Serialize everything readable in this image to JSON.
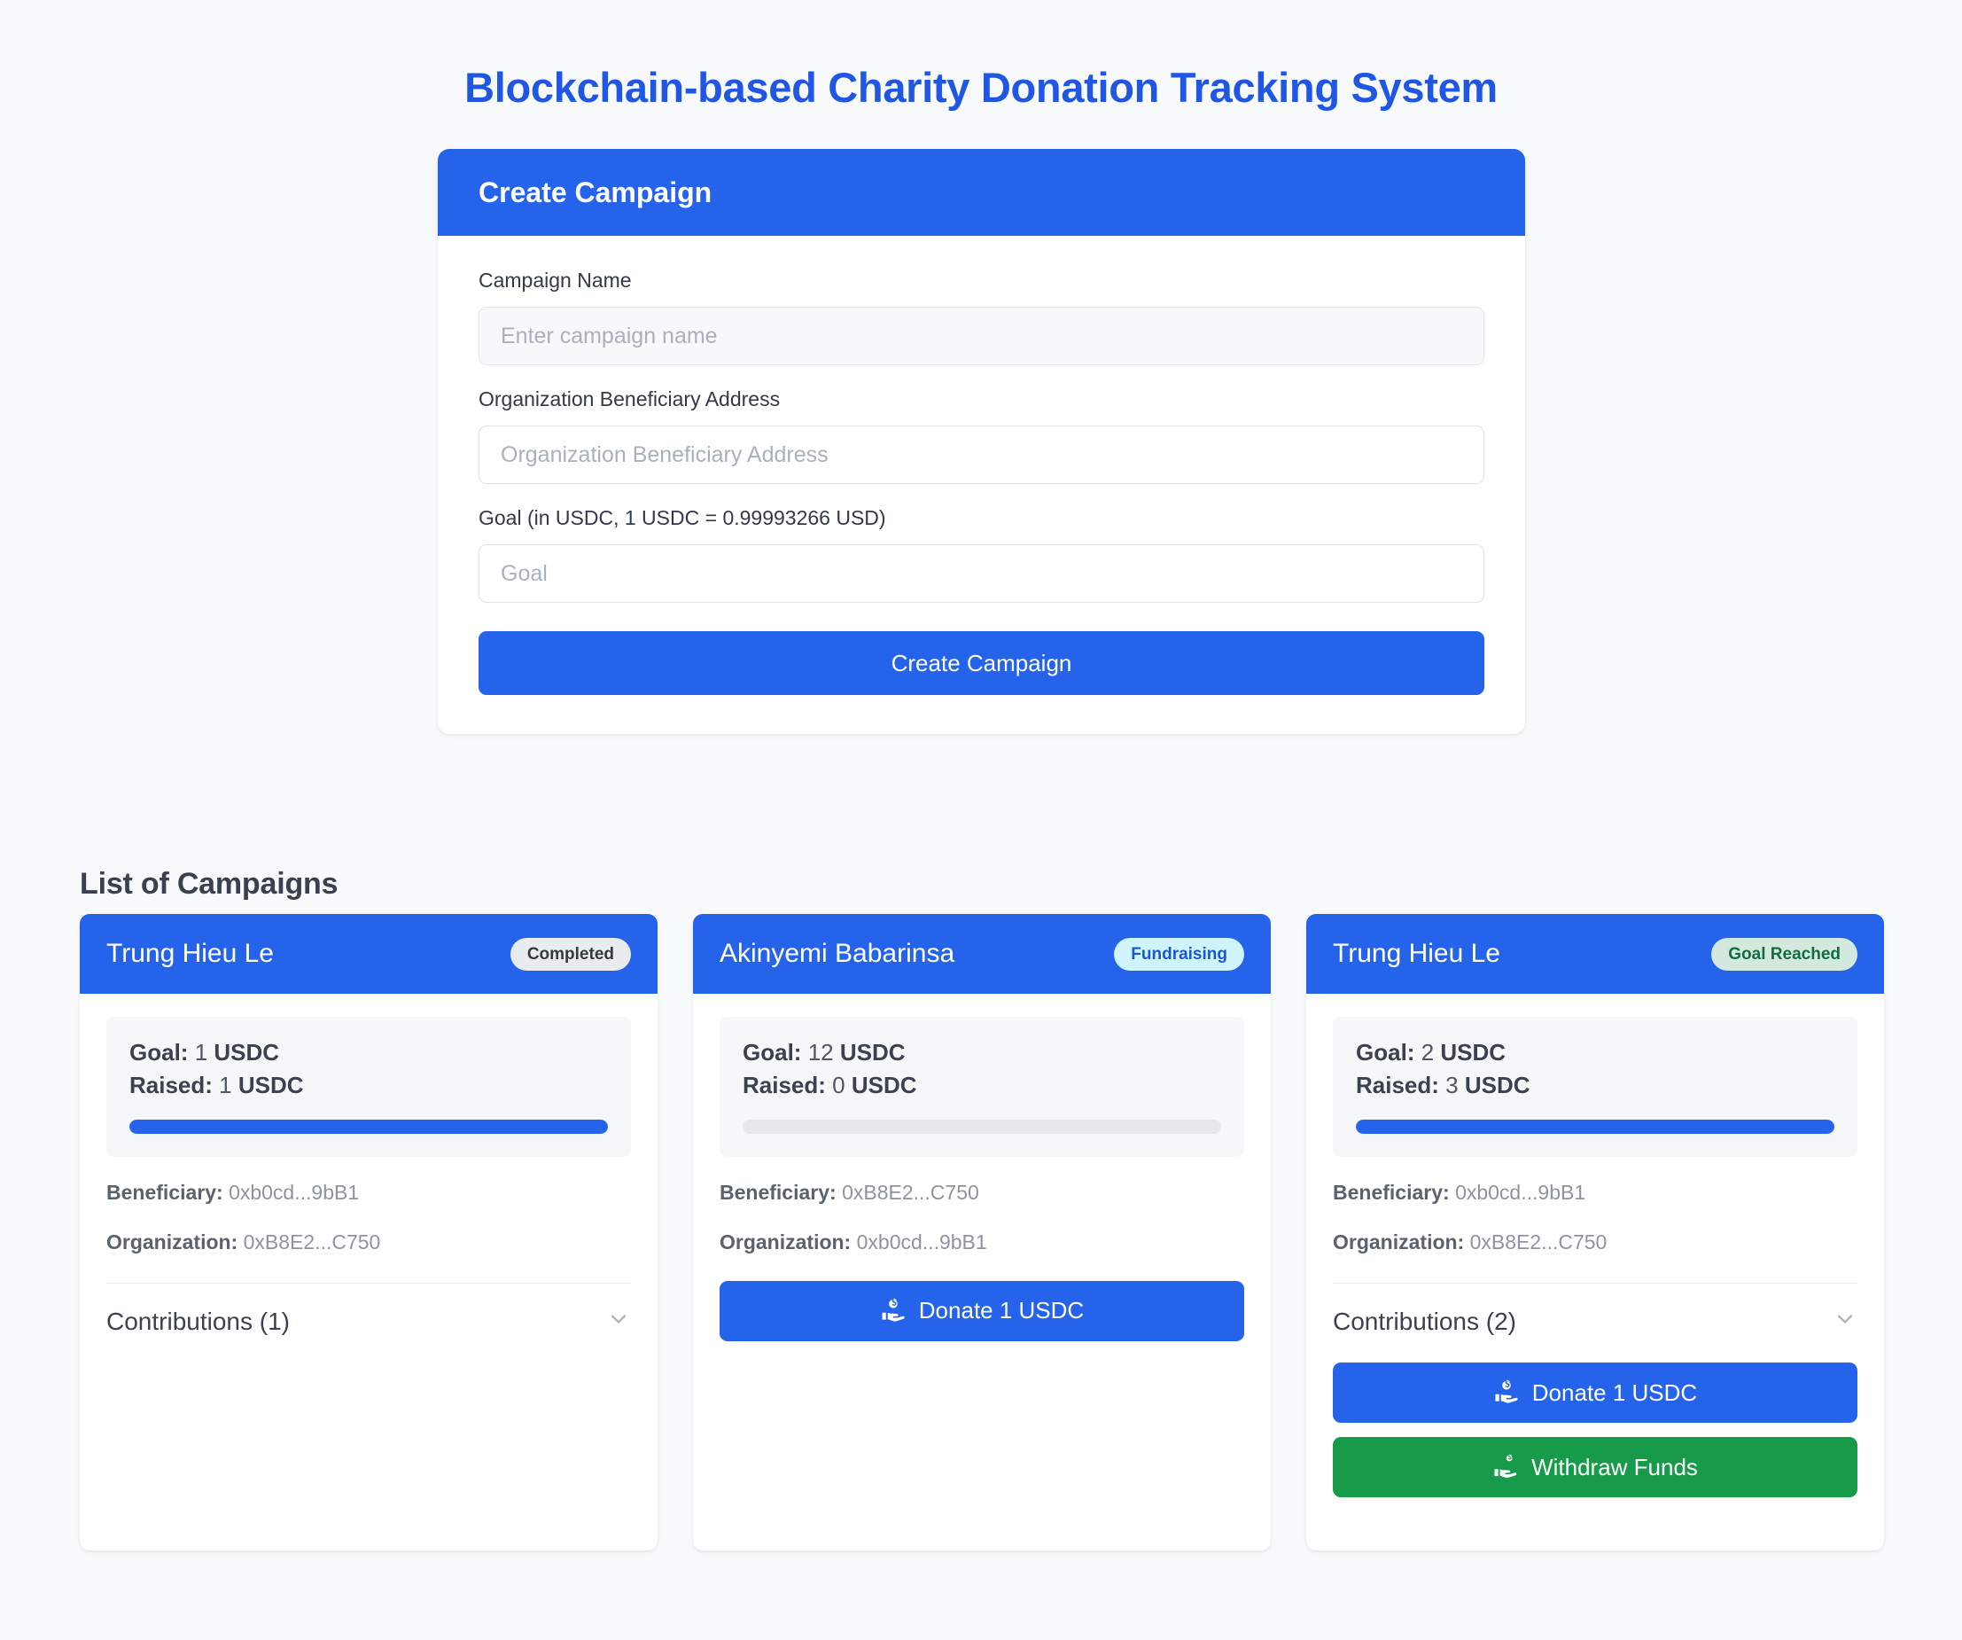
{
  "app": {
    "title": "Blockchain-based Charity Donation Tracking System",
    "accent_color": "#2563eb",
    "title_color": "#1f56e3",
    "background_color": "#f8f9fa"
  },
  "create_campaign": {
    "header": "Create Campaign",
    "fields": {
      "name": {
        "label": "Campaign Name",
        "placeholder": "Enter campaign name",
        "value": ""
      },
      "beneficiary": {
        "label": "Organization Beneficiary Address",
        "placeholder": "Organization Beneficiary Address",
        "value": ""
      },
      "goal": {
        "label": "Goal (in USDC, 1 USDC = 0.99993266 USD)",
        "placeholder": "Goal",
        "value": ""
      }
    },
    "submit_label": "Create Campaign"
  },
  "campaign_list": {
    "heading": "List of Campaigns",
    "labels": {
      "goal": "Goal:",
      "raised": "Raised:",
      "beneficiary": "Beneficiary:",
      "organization": "Organization:",
      "currency": "USDC"
    },
    "cards": [
      {
        "title": "Trung Hieu Le",
        "status": "Completed",
        "status_style": "badge-completed",
        "goal_amount": "1",
        "goal_currency": "USDC",
        "raised_amount": "1",
        "raised_currency": "USDC",
        "progress_percent": 100,
        "beneficiary_label": "Beneficiary:",
        "beneficiary_value": "0xb0cd...9bB1",
        "organization_label": "Organization:",
        "organization_value": "0xB8E2...C750",
        "contributions_label": "Contributions (1)",
        "has_contributions": true,
        "donate_label": null,
        "withdraw_label": null
      },
      {
        "title": "Akinyemi Babarinsa",
        "status": "Fundraising",
        "status_style": "badge-fundraising",
        "goal_amount": "12",
        "goal_currency": "USDC",
        "raised_amount": "0",
        "raised_currency": "USDC",
        "progress_percent": 0,
        "beneficiary_label": "Beneficiary:",
        "beneficiary_value": "0xB8E2...C750",
        "organization_label": "Organization:",
        "organization_value": "0xb0cd...9bB1",
        "contributions_label": null,
        "has_contributions": false,
        "donate_label": "Donate 1 USDC",
        "withdraw_label": null
      },
      {
        "title": "Trung Hieu Le",
        "status": "Goal Reached",
        "status_style": "badge-goalreached",
        "goal_amount": "2",
        "goal_currency": "USDC",
        "raised_amount": "3",
        "raised_currency": "USDC",
        "progress_percent": 100,
        "beneficiary_label": "Beneficiary:",
        "beneficiary_value": "0xb0cd...9bB1",
        "organization_label": "Organization:",
        "organization_value": "0xB8E2...C750",
        "contributions_label": "Contributions (2)",
        "has_contributions": true,
        "donate_label": "Donate 1 USDC",
        "withdraw_label": "Withdraw Funds"
      }
    ]
  },
  "icons": {
    "donate": "hand-holding-dollar-icon",
    "withdraw": "hand-holding-dollar-icon",
    "expand": "chevron-down-icon"
  }
}
